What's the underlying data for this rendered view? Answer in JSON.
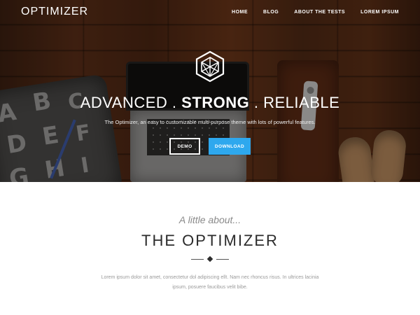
{
  "brand": {
    "name": "OPTIMIZER"
  },
  "nav": {
    "items": [
      {
        "label": "HOME"
      },
      {
        "label": "BLOG"
      },
      {
        "label": "ABOUT THE TESTS"
      },
      {
        "label": "LOREM IPSUM"
      }
    ]
  },
  "hero": {
    "headline_part1": "ADVANCED . ",
    "headline_strong": "STRONG",
    "headline_part2": " . RELIABLE",
    "tagline": "The Optimizer, an easy to customizable multi-purpose theme with lots of powerful features.",
    "buttons": {
      "demo": "DEMO",
      "download": "DOWNLOAD"
    },
    "download_color": "#2ea8ee",
    "pillow_letters": [
      "A",
      "B",
      "C",
      "D",
      "E",
      "F",
      "G",
      "H",
      "I"
    ]
  },
  "about": {
    "subtitle": "A little about...",
    "title": "THE OPTIMIZER",
    "text": "Lorem ipsum dolor sit amet, consectetur dol adipiscing ellt. Nam nec rhoncus risus. In ultrices lacinia ipsum, posuere faucibus velit bibe."
  }
}
